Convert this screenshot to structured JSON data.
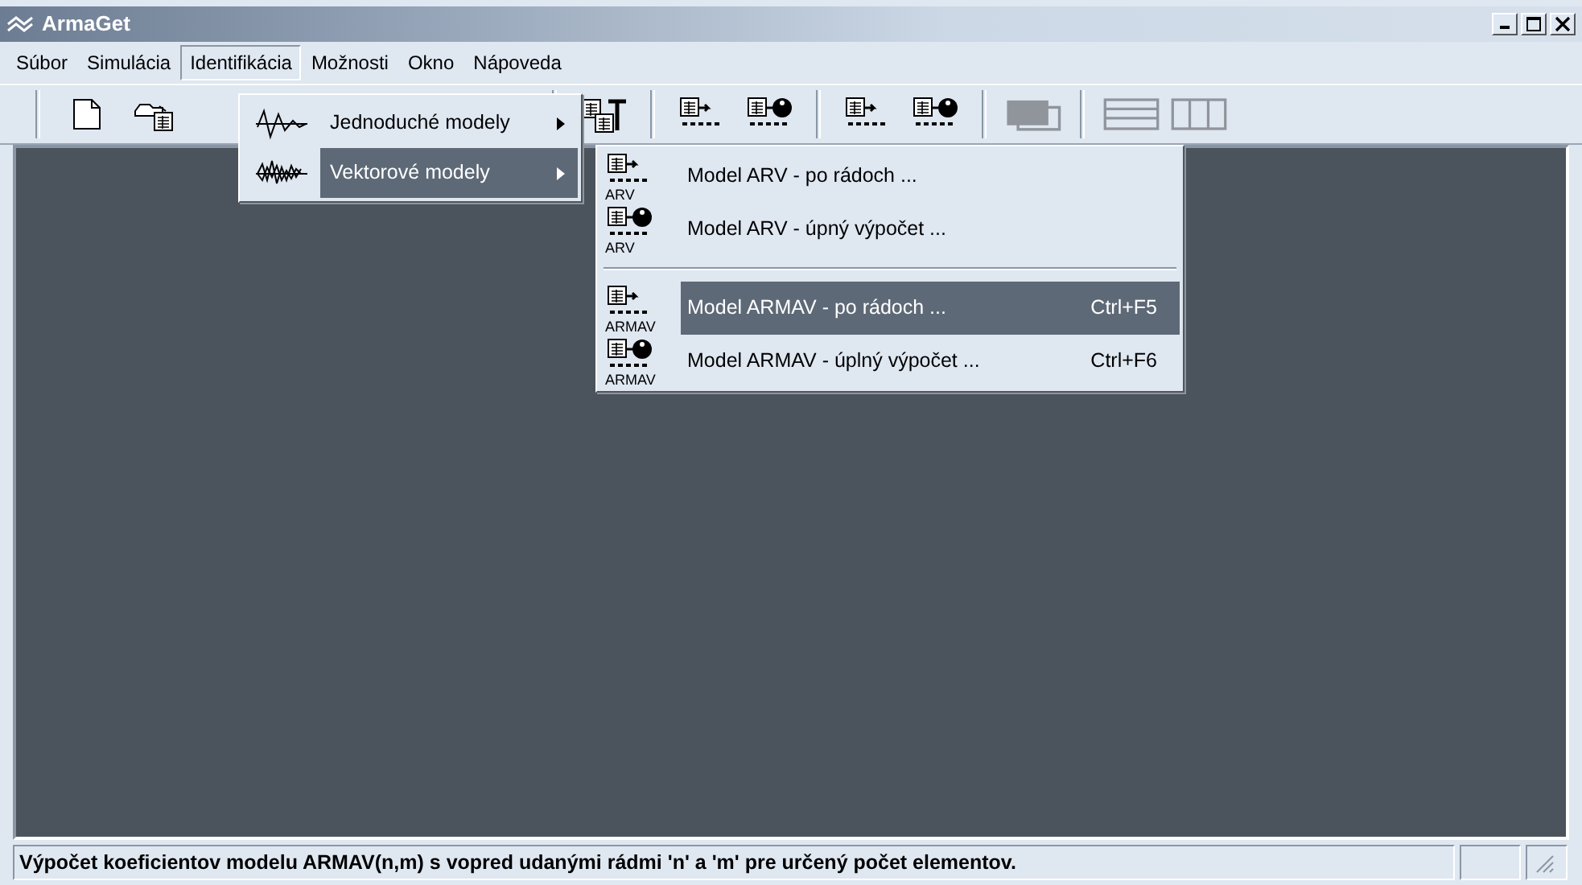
{
  "window": {
    "title": "ArmaGet"
  },
  "menu_bar": [
    {
      "label": "Súbor",
      "selected": false
    },
    {
      "label": "Simulácia",
      "selected": false
    },
    {
      "label": "Identifikácia",
      "selected": true
    },
    {
      "label": "Možnosti",
      "selected": false
    },
    {
      "label": "Okno",
      "selected": false
    },
    {
      "label": "Nápoveda",
      "selected": false
    }
  ],
  "toolbar": [
    {
      "kind": "new",
      "disabled": false
    },
    {
      "kind": "open",
      "disabled": false
    },
    {
      "kind": "hidden"
    },
    {
      "kind": "separator"
    },
    {
      "kind": "text",
      "disabled": false
    },
    {
      "kind": "separator"
    },
    {
      "kind": "calc",
      "disabled": false
    },
    {
      "kind": "calc-full",
      "disabled": false
    },
    {
      "kind": "separator"
    },
    {
      "kind": "calc",
      "disabled": false
    },
    {
      "kind": "calc-full",
      "disabled": false
    },
    {
      "kind": "separator"
    },
    {
      "kind": "pages",
      "disabled": true
    },
    {
      "kind": "separator"
    },
    {
      "kind": "rows",
      "disabled": true
    },
    {
      "kind": "cols",
      "disabled": true
    }
  ],
  "dropdown": [
    {
      "label": "Jednoduché modely",
      "kind": "simple",
      "selected": false
    },
    {
      "label": "Vektorové modely",
      "kind": "vector",
      "selected": true
    }
  ],
  "submenu": [
    {
      "kind": "step",
      "icon_caption": "ARV",
      "label": "Model ARV - po rádoch ...",
      "selected": false
    },
    {
      "kind": "full",
      "icon_caption": "ARV",
      "label": "Model ARV - úpný výpočet ...",
      "selected": false
    },
    {
      "kind": "separator"
    },
    {
      "kind": "step",
      "icon_caption": "ARMAV",
      "label": "Model ARMAV - po rádoch ...",
      "shortcut": "Ctrl+F5",
      "selected": true
    },
    {
      "kind": "full",
      "icon_caption": "ARMAV",
      "label": "Model ARMAV - úplný výpočet ...",
      "shortcut": "Ctrl+F6",
      "selected": false
    }
  ],
  "status_bar": {
    "text": "Výpočet koeficientov modelu ARMAV(n,m) s vopred udanými rádmi 'n' a 'm' pre určený počet elementov."
  }
}
